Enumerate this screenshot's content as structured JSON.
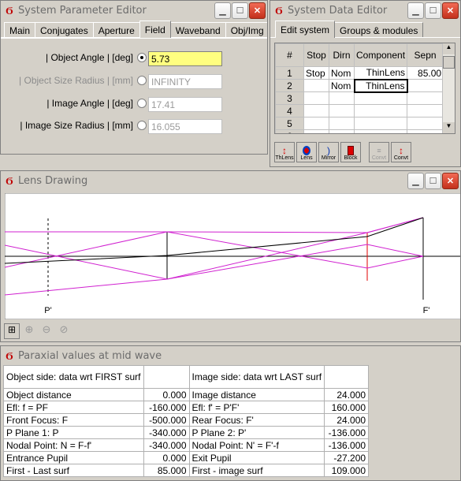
{
  "param_editor": {
    "title": "System Parameter Editor",
    "tabs": [
      "Main",
      "Conjugates",
      "Aperture",
      "Field",
      "Waveband",
      "Obj/Img"
    ],
    "active_tab": "Field",
    "rows": [
      {
        "label": "| Object Angle |  [deg]",
        "value": "5.73",
        "selected": true,
        "enabled": true
      },
      {
        "label": "| Object Size Radius |  [mm]",
        "value": "INFINITY",
        "selected": false,
        "enabled": false
      },
      {
        "label": "| Image Angle |  [deg]",
        "value": "17.41",
        "selected": false,
        "enabled": true
      },
      {
        "label": "| Image Size Radius |  [mm]",
        "value": "16.055",
        "selected": false,
        "enabled": true
      }
    ]
  },
  "data_editor": {
    "title": "System Data Editor",
    "tabs": [
      "Edit system",
      "Groups & modules"
    ],
    "columns": [
      "#",
      "Stop",
      "Dirn",
      "Component",
      "Sepn"
    ],
    "rows": [
      [
        "1",
        "Stop",
        "Nom",
        "ThinLens",
        "85.00"
      ],
      [
        "2",
        "",
        "Nom",
        "ThinLens",
        ""
      ],
      [
        "3",
        "",
        "",
        "",
        ""
      ],
      [
        "4",
        "",
        "",
        "",
        ""
      ],
      [
        "5",
        "",
        "",
        "",
        ""
      ],
      [
        "6",
        "",
        "",
        "",
        ""
      ]
    ],
    "tools": [
      "ThLens",
      "Lens",
      "Mirror",
      "Block",
      "Convt",
      "Convt"
    ],
    "tool_icons": [
      "thinlens-icon",
      "lens-icon",
      "mirror-icon",
      "block-icon",
      "convert-disabled-icon",
      "convert-icon"
    ]
  },
  "lens_drawing": {
    "title": "Lens Drawing",
    "label_entrance": "P'",
    "label_focus": "F'"
  },
  "paraxial": {
    "title": "Paraxial values at mid wave",
    "header_left": "Object side: data wrt FIRST surf",
    "header_right": "Image side: data wrt LAST surf",
    "rows": [
      {
        "l_label": "Object distance",
        "l_value": "0.000",
        "r_label": "Image distance",
        "r_value": "24.000"
      },
      {
        "l_label": "Efl:        f = PF",
        "l_value": "-160.000",
        "r_label": "Efl:        f' = P'F'",
        "r_value": "160.000"
      },
      {
        "l_label": "Front Focus:  F",
        "l_value": "-500.000",
        "r_label": "Rear Focus:  F'",
        "r_value": "24.000"
      },
      {
        "l_label": "P Plane 1:     P",
        "l_value": "-340.000",
        "r_label": "P Plane 2:     P'",
        "r_value": "-136.000"
      },
      {
        "l_label": "Nodal Point:  N = F-f'",
        "l_value": "-340.000",
        "r_label": "Nodal Point:  N' = F'-f",
        "r_value": "-136.000"
      },
      {
        "l_label": "Entrance Pupil",
        "l_value": "0.000",
        "r_label": "Exit Pupil",
        "r_value": "-27.200"
      },
      {
        "l_label": "First - Last surf",
        "l_value": "85.000",
        "r_label": "First - image surf",
        "r_value": "109.000"
      }
    ]
  },
  "colors": {
    "ray": "#d020d0",
    "axis": "#000000",
    "field": "#ffff80",
    "lens_marker": "#e00000"
  }
}
